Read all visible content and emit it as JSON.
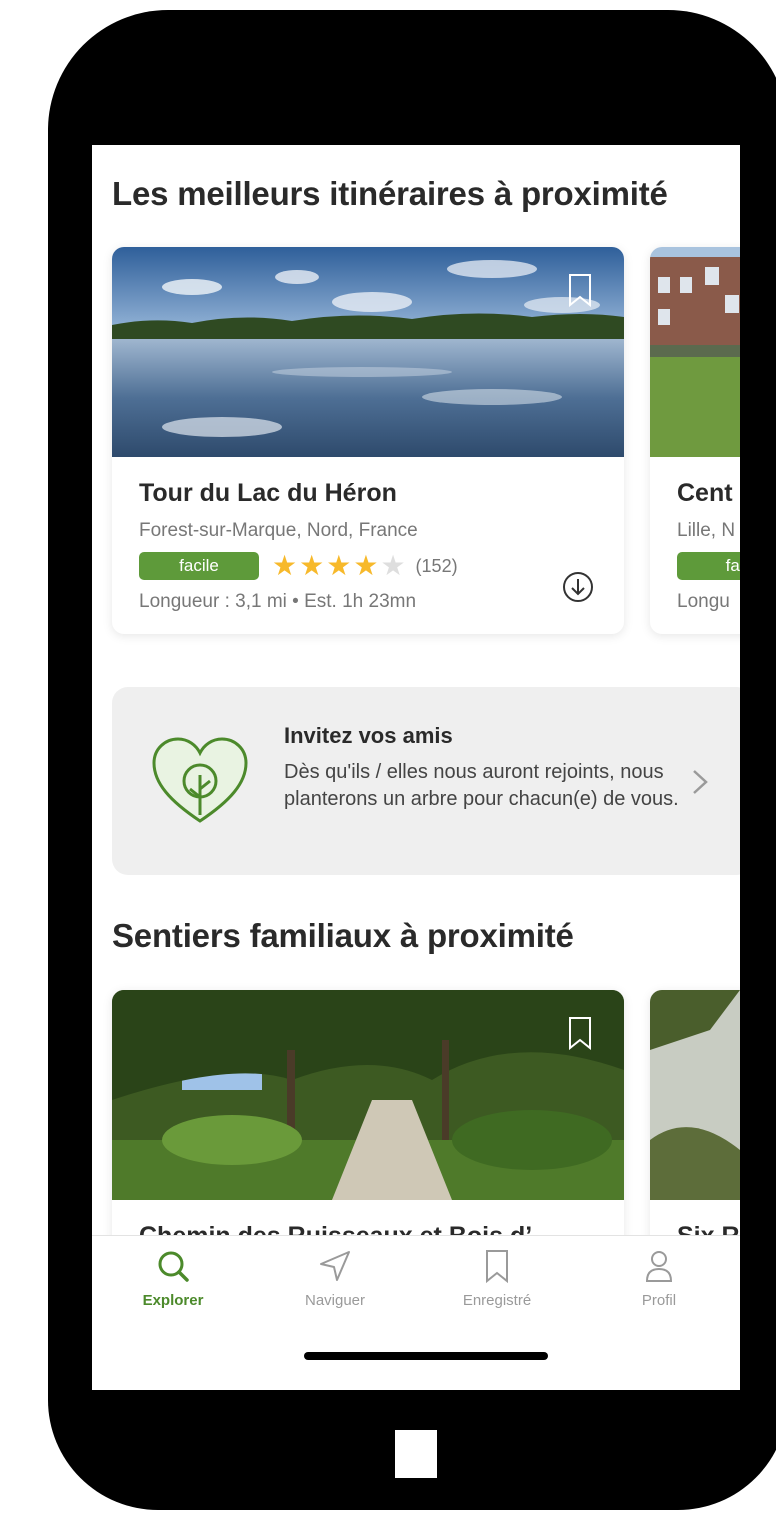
{
  "sections": {
    "top_trails_title": "Les meilleurs itinéraires à proximité",
    "family_trails_title": "Sentiers familiaux à proximité"
  },
  "top_trails": [
    {
      "title": "Tour du Lac du Héron",
      "location": "Forest-sur-Marque, Nord, France",
      "difficulty": "facile",
      "rating": 4,
      "rating_max": 5,
      "review_count": "(152)",
      "meta": "Longueur : 3,1 mi  •  Est. 1h 23mn"
    },
    {
      "title": "Cent",
      "location": "Lille, N",
      "difficulty": "fac",
      "meta": "Longu"
    }
  ],
  "invite": {
    "title": "Invitez vos amis",
    "body": "Dès qu'ils / elles nous auront rejoints, nous planterons un arbre pour chacun(e) de vous."
  },
  "family_trails": [
    {
      "title": "Chemin des Ruisseaux et Bois d’"
    },
    {
      "title": "Six R"
    }
  ],
  "tabbar": {
    "items": [
      {
        "label": "Explorer",
        "icon": "search-icon",
        "active": true
      },
      {
        "label": "Naviguer",
        "icon": "navigate-arrow-icon",
        "active": false
      },
      {
        "label": "Enregistré",
        "icon": "bookmark-icon",
        "active": false
      },
      {
        "label": "Profil",
        "icon": "profile-icon",
        "active": false
      }
    ]
  },
  "colors": {
    "accent_green": "#5e9a3a",
    "active_tab": "#4c8a2b",
    "star": "#f7b92b",
    "star_empty": "#dedede"
  }
}
